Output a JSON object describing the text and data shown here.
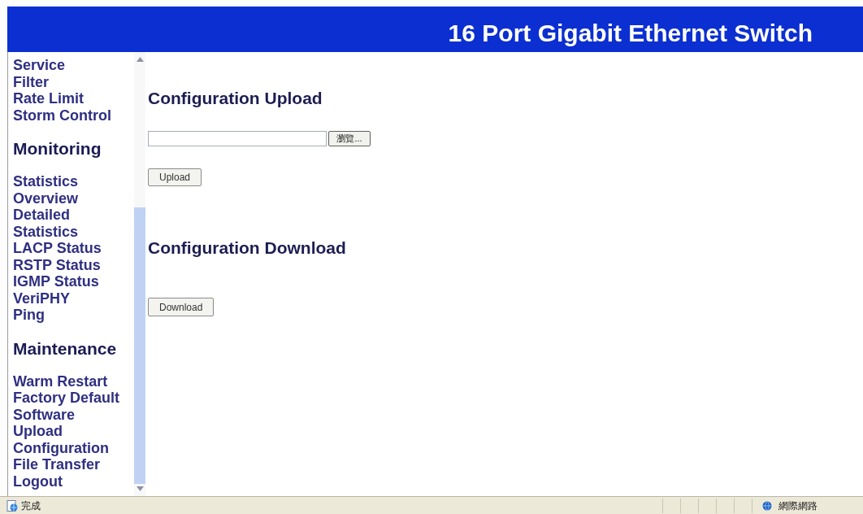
{
  "header": {
    "title": "16 Port Gigabit Ethernet Switch"
  },
  "sidebar": {
    "groups": [
      {
        "items": [
          "Service",
          "Filter",
          "Rate Limit",
          "Storm Control"
        ]
      },
      {
        "heading": "Monitoring",
        "items": [
          "Statistics Overview",
          "Detailed Statistics",
          "LACP Status",
          "RSTP Status",
          "IGMP Status",
          "VeriPHY",
          "Ping"
        ]
      },
      {
        "heading": "Maintenance",
        "items": [
          "Warm Restart",
          "Factory Default",
          "Software Upload",
          "Configuration File Transfer",
          "Logout"
        ]
      }
    ]
  },
  "content": {
    "sections": [
      {
        "title": "Configuration Upload",
        "file_field": {
          "browse_button": "瀏覽..."
        },
        "button": "Upload"
      },
      {
        "title": "Configuration Download",
        "button": "Download"
      }
    ]
  },
  "status_bar": {
    "status": "完成",
    "zone": "網際網路"
  }
}
